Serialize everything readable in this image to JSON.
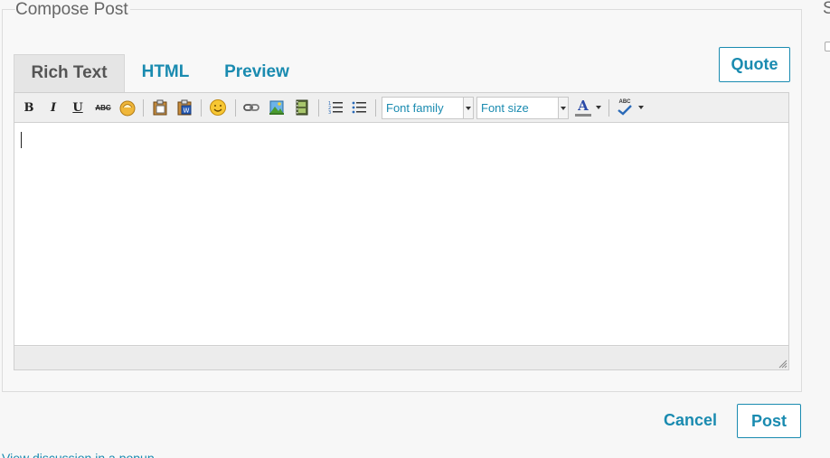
{
  "compose": {
    "legend": "Compose Post",
    "side_legend": "S"
  },
  "tabs": [
    {
      "label": "Rich Text",
      "active": true
    },
    {
      "label": "HTML",
      "active": false
    },
    {
      "label": "Preview",
      "active": false
    }
  ],
  "buttons": {
    "quote": "Quote",
    "post": "Post",
    "cancel": "Cancel"
  },
  "toolbar": {
    "bold": "B",
    "italic": "I",
    "underline": "U",
    "strike": "ABC",
    "font_family": "Font family",
    "font_size": "Font size",
    "text_color_glyph": "A",
    "spell_glyph": "ABC"
  },
  "icons": [
    "bold-icon",
    "italic-icon",
    "underline-icon",
    "strikethrough-icon",
    "clean-format-icon",
    "paste-icon",
    "paste-word-icon",
    "emoticon-icon",
    "link-icon",
    "image-icon",
    "video-icon",
    "ordered-list-icon",
    "bullet-list-icon",
    "text-color-icon",
    "spellcheck-icon",
    "resize-handle-icon"
  ],
  "footer": {
    "view_popup_link": "View discussion in a popup"
  },
  "colors": {
    "accent": "#1a8bb0",
    "tab_active_bg": "#e5e5e5",
    "background": "#f7f7f7"
  }
}
